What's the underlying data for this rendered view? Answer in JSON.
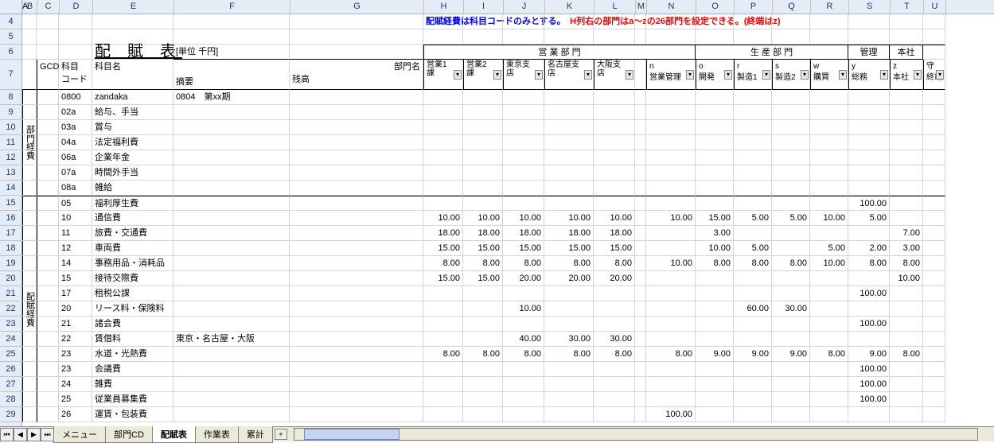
{
  "colHeaders": [
    "A",
    "B",
    "C",
    "D",
    "E",
    "F",
    "G",
    "H",
    "I",
    "J",
    "K",
    "L",
    "M",
    "N",
    "O",
    "P",
    "Q",
    "R",
    "S",
    "T",
    "U"
  ],
  "selectedCol": "A",
  "rowNums": [
    4,
    5,
    6,
    7,
    8,
    9,
    10,
    11,
    12,
    13,
    14,
    15,
    16,
    17,
    18,
    19,
    20,
    21,
    22,
    23,
    24,
    25,
    26,
    27,
    28,
    29
  ],
  "note1": "配賦経費は科目コードのみとする。",
  "note2": "H列右の部門はa～zの26部門を設定できる。(終端はz)",
  "titleMain": "配 賦 表",
  "unit": "[単位 千円]",
  "grpSales": "営 業 部 門",
  "grpProd": "生 産 部 門",
  "grpAdmin": "管理",
  "grpHQ": "本社",
  "hdr": {
    "gcd": "GCD",
    "kcd": "科目\nコード",
    "kname": "科目名",
    "note": "摘要",
    "bal": "残高",
    "dept": "部門名"
  },
  "depts": [
    {
      "c": "",
      "n": "営業1\n課"
    },
    {
      "c": "",
      "n": "営業2\n課"
    },
    {
      "c": "",
      "n": "東京支\n店"
    },
    {
      "c": "",
      "n": "名古屋支\n店"
    },
    {
      "c": "",
      "n": "大阪支\n店"
    },
    {
      "c": "n",
      "n": "営業管理"
    },
    {
      "c": "o",
      "n": "開発"
    },
    {
      "c": "r",
      "n": "製造1"
    },
    {
      "c": "s",
      "n": "製造2"
    },
    {
      "c": "w",
      "n": "購買"
    },
    {
      "c": "y",
      "n": "総務"
    },
    {
      "c": "z",
      "n": "本社"
    },
    {
      "c": "守",
      "n": "終端"
    }
  ],
  "sideLabel1": "部門経費",
  "sideLabel2": "配賦経費",
  "rows1": [
    {
      "code": "0800",
      "name": "zandaka",
      "note": "0804　第xx期"
    },
    {
      "code": "02a",
      "name": "給与、手当"
    },
    {
      "code": "03a",
      "name": "賞与"
    },
    {
      "code": "04a",
      "name": "法定福利費"
    },
    {
      "code": "06a",
      "name": "企業年金"
    },
    {
      "code": "07a",
      "name": "時間外手当"
    },
    {
      "code": "08a",
      "name": "雑給"
    }
  ],
  "rows2": [
    {
      "code": "05",
      "name": "福利厚生費",
      "v": [
        "",
        "",
        "",
        "",
        "",
        "",
        "",
        "",
        "",
        "",
        "100.00",
        ""
      ]
    },
    {
      "code": "10",
      "name": "通信費",
      "v": [
        "10.00",
        "10.00",
        "10.00",
        "10.00",
        "10.00",
        "10.00",
        "15.00",
        "5.00",
        "5.00",
        "10.00",
        "5.00",
        ""
      ]
    },
    {
      "code": "11",
      "name": "旅費・交通費",
      "v": [
        "18.00",
        "18.00",
        "18.00",
        "18.00",
        "18.00",
        "",
        "3.00",
        "",
        "",
        "",
        "",
        "7.00"
      ]
    },
    {
      "code": "12",
      "name": "車両費",
      "v": [
        "15.00",
        "15.00",
        "15.00",
        "15.00",
        "15.00",
        "",
        "10.00",
        "5.00",
        "",
        "5.00",
        "2.00",
        "3.00"
      ]
    },
    {
      "code": "14",
      "name": "事務用品・消耗品",
      "v": [
        "8.00",
        "8.00",
        "8.00",
        "8.00",
        "8.00",
        "10.00",
        "8.00",
        "8.00",
        "8.00",
        "10.00",
        "8.00",
        "8.00"
      ]
    },
    {
      "code": "15",
      "name": "接待交際費",
      "v": [
        "15.00",
        "15.00",
        "20.00",
        "20.00",
        "20.00",
        "",
        "",
        "",
        "",
        "",
        "",
        "10.00"
      ]
    },
    {
      "code": "17",
      "name": "租税公課",
      "v": [
        "",
        "",
        "",
        "",
        "",
        "",
        "",
        "",
        "",
        "",
        "100.00",
        ""
      ]
    },
    {
      "code": "20",
      "name": "リース料・保険料",
      "v": [
        "",
        "",
        "10.00",
        "",
        "",
        "",
        "",
        "60.00",
        "30.00",
        "",
        "",
        ""
      ]
    },
    {
      "code": "21",
      "name": "諸会費",
      "v": [
        "",
        "",
        "",
        "",
        "",
        "",
        "",
        "",
        "",
        "",
        "100.00",
        ""
      ]
    },
    {
      "code": "22",
      "name": "賃借料",
      "note": "東京・名古屋・大阪",
      "v": [
        "",
        "",
        "40.00",
        "30.00",
        "30.00",
        "",
        "",
        "",
        "",
        "",
        "",
        ""
      ]
    },
    {
      "code": "23",
      "name": "水道・光熱費",
      "v": [
        "8.00",
        "8.00",
        "8.00",
        "8.00",
        "8.00",
        "8.00",
        "9.00",
        "9.00",
        "9.00",
        "8.00",
        "9.00",
        "8.00"
      ]
    },
    {
      "code": "23",
      "name": "会議費",
      "v": [
        "",
        "",
        "",
        "",
        "",
        "",
        "",
        "",
        "",
        "",
        "100.00",
        ""
      ]
    },
    {
      "code": "24",
      "name": "雑費",
      "v": [
        "",
        "",
        "",
        "",
        "",
        "",
        "",
        "",
        "",
        "",
        "100.00",
        ""
      ]
    },
    {
      "code": "25",
      "name": "従業員募集費",
      "v": [
        "",
        "",
        "",
        "",
        "",
        "",
        "",
        "",
        "",
        "",
        "100.00",
        ""
      ]
    },
    {
      "code": "26",
      "name": "運賃・包装費",
      "v": [
        "",
        "",
        "",
        "",
        "",
        "100.00",
        "",
        "",
        "",
        "",
        "",
        ""
      ]
    }
  ],
  "tabs": [
    "メニュー",
    "部門CD",
    "配賦表",
    "作業表",
    "累計"
  ],
  "activeTab": "配賦表"
}
